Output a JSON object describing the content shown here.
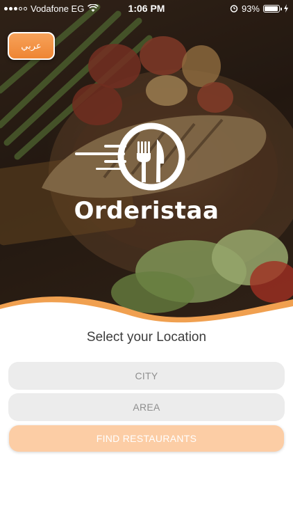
{
  "status_bar": {
    "carrier": "Vodafone EG",
    "time": "1:06 PM",
    "battery": "93%",
    "battery_level": 0.93,
    "icons": [
      "signal-icon",
      "wifi-icon",
      "alarm-icon",
      "battery-icon",
      "charging-icon"
    ]
  },
  "header": {
    "language_button": "عربي",
    "brand": "Orderistaa",
    "logo_icon": "fork-knife-icon"
  },
  "location": {
    "title": "Select your Location",
    "city_label": "CITY",
    "area_label": "AREA",
    "find_button": "FIND RESTAURANTS"
  },
  "colors": {
    "accent": "#ee8533",
    "find_button_bg": "#fccda5",
    "field_bg": "#ececec",
    "field_text": "#8e8e8e",
    "title_text": "#3c3c3c"
  }
}
